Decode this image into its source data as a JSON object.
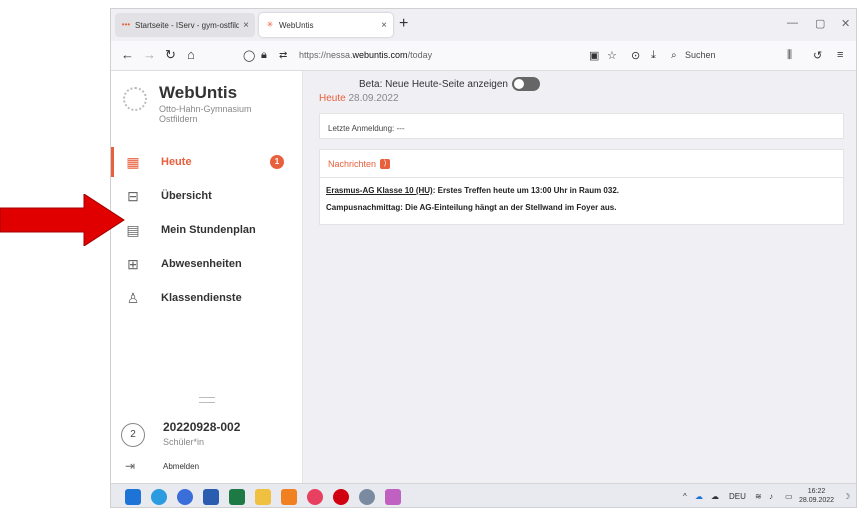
{
  "browser": {
    "tabs": [
      {
        "label": "Startseite - IServ - gym-ostfilde",
        "close": "×"
      },
      {
        "label": "WebUntis",
        "close": "×"
      }
    ],
    "newtab": "+",
    "url_prefix": "https://nessa.",
    "url_host": "webuntis.com",
    "url_path": "/today",
    "search_placeholder": "Suchen",
    "window_controls": [
      "—",
      "▢",
      "✕"
    ]
  },
  "sidebar": {
    "brand": "WebUntis",
    "school_line1": "Otto-Hahn-Gymnasium",
    "school_line2": "Ostfildern",
    "items": [
      {
        "label": "Heute",
        "icon": "dashboard-icon",
        "badge": "1"
      },
      {
        "label": "Übersicht",
        "icon": "overview-icon"
      },
      {
        "label": "Mein Stundenplan",
        "icon": "calendar-icon"
      },
      {
        "label": "Abwesenheiten",
        "icon": "absence-icon"
      },
      {
        "label": "Klassendienste",
        "icon": "class-duty-icon"
      }
    ],
    "user": {
      "avatar": "2",
      "name": "20220928-002",
      "role": "Schüler*in",
      "logout": "Abmelden"
    }
  },
  "main": {
    "beta_label": "Beta: Neue Heute-Seite anzeigen",
    "today_label": "Heute",
    "today_date": "28.09.2022",
    "last_login": "Letzte Anmeldung: ---",
    "news_title": "Nachrichten",
    "news": [
      {
        "link": "Erasmus-AG Klasse 10 (HU)",
        "text": ": Erstes Treffen heute um 13:00 Uhr in Raum 032."
      },
      {
        "link": "",
        "text": "Campusnachmittag: Die AG-Einteilung hängt an der Stellwand im Foyer aus."
      }
    ]
  },
  "taskbar": {
    "lang": "DEU",
    "time": "16:22",
    "date": "28.09.2022"
  },
  "colors": {
    "accent": "#e8603c",
    "arrow": "#e00000"
  }
}
